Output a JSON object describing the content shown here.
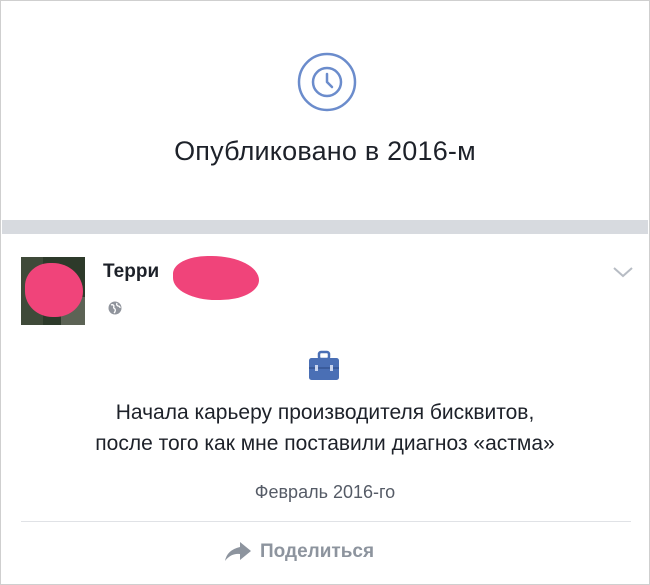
{
  "memory_header": {
    "icon": "clock-icon",
    "title": "Опубликовано в 2016-м",
    "accent_color": "#5b7bc0"
  },
  "post": {
    "author_name": "Терри",
    "privacy_icon": "globe-icon",
    "menu_icon": "chevron-down-icon",
    "life_event_icon": "briefcase-icon",
    "story_lines": [
      "Начала карьеру производителя бисквитов,",
      "после того как мне поставили диагноз «астма»"
    ],
    "date": "Февраль 2016-го",
    "share_label": "Поделиться",
    "redaction_color": "#f0447a"
  }
}
